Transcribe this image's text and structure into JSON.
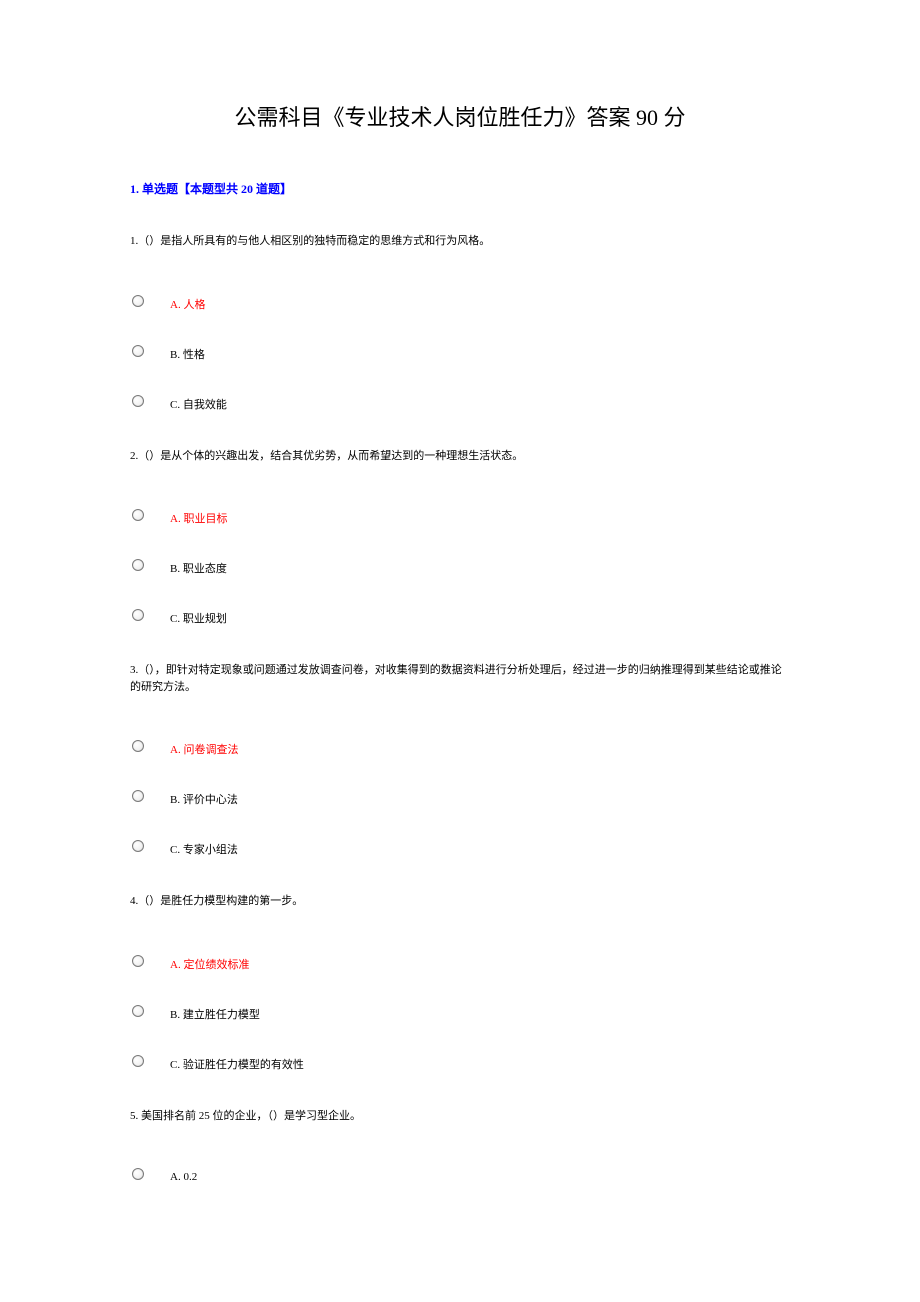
{
  "title": "公需科目《专业技术人岗位胜任力》答案 90 分",
  "section_header": "1. 单选题【本题型共 20 道题】",
  "questions": [
    {
      "stem": "1.（）是指人所具有的与他人相区别的独特而稳定的思维方式和行为风格。",
      "options": [
        {
          "label": "A. 人格",
          "answer": true
        },
        {
          "label": "B. 性格",
          "answer": false
        },
        {
          "label": "C. 自我效能",
          "answer": false
        }
      ]
    },
    {
      "stem": "2.（）是从个体的兴趣出发，结合其优劣势，从而希望达到的一种理想生活状态。",
      "options": [
        {
          "label": "A. 职业目标",
          "answer": true
        },
        {
          "label": "B. 职业态度",
          "answer": false
        },
        {
          "label": "C. 职业规划",
          "answer": false
        }
      ]
    },
    {
      "stem": "3.（），即针对特定现象或问题通过发放调查问卷，对收集得到的数据资料进行分析处理后，经过进一步的归纳推理得到某些结论或推论的研究方法。",
      "options": [
        {
          "label": "A. 问卷调查法",
          "answer": true
        },
        {
          "label": "B. 评价中心法",
          "answer": false
        },
        {
          "label": "C. 专家小组法",
          "answer": false
        }
      ]
    },
    {
      "stem": "4.（）是胜任力模型构建的第一步。",
      "options": [
        {
          "label": "A. 定位绩效标准",
          "answer": true
        },
        {
          "label": "B. 建立胜任力模型",
          "answer": false
        },
        {
          "label": "C. 验证胜任力模型的有效性",
          "answer": false
        }
      ]
    },
    {
      "stem": "5. 美国排名前 25 位的企业，（）是学习型企业。",
      "options": [
        {
          "label": "A. 0.2",
          "answer": false
        }
      ]
    }
  ]
}
